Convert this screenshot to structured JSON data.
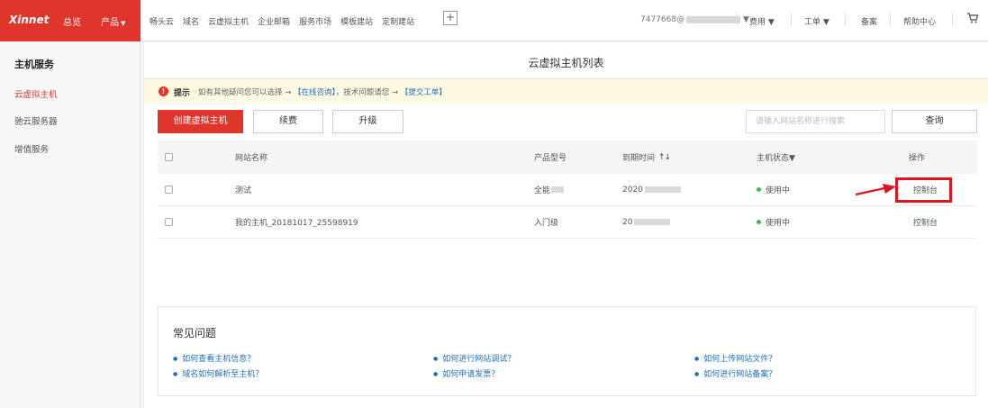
{
  "header": {
    "logo": "Xinnet",
    "overview": "总览",
    "products": "产品",
    "links": [
      "畅头云",
      "域名",
      "云虚拟主机",
      "企业邮箱",
      "服务市场",
      "模板建站",
      "定制建站"
    ],
    "plus": "+",
    "account": "7477668@",
    "fees": "费用",
    "tickets": "工单",
    "record": "备案",
    "help": "帮助中心"
  },
  "sidebar": {
    "title": "主机服务",
    "items": [
      {
        "label": "云虚拟主机",
        "active": true
      },
      {
        "label": "驰云服务器",
        "active": false
      },
      {
        "label": "增值服务",
        "active": false
      }
    ]
  },
  "main": {
    "title": "云虚拟主机列表",
    "tip": {
      "label": "提示",
      "text_a": "如有其他疑问您可以选择 → ",
      "link_a": "【在线咨询】",
      "text_b": "，技术问题请您 → ",
      "link_b": "【提交工单】"
    },
    "buttons": {
      "create": "创建虚拟主机",
      "renew": "续费",
      "upgrade": "升级",
      "query": "查询"
    },
    "search_placeholder": "请输入网站名称进行搜索",
    "table": {
      "headers": {
        "name": "网站名称",
        "model": "产品型号",
        "expire": "到期时间",
        "sort": "↑↓",
        "status": "主机状态▼",
        "op": "操作"
      },
      "rows": [
        {
          "name": "测试",
          "model": "全能",
          "expire": "2020",
          "status": "使用中",
          "op": "控制台"
        },
        {
          "name": "我的主机_20181017_25598919",
          "model": "入门级",
          "expire": "20",
          "status": "使用中",
          "op": "控制台"
        }
      ]
    }
  },
  "faq": {
    "title": "常见问题",
    "links": [
      "如何查看主机信息？",
      "如何进行网站调试？",
      "如何上传网站文件？",
      "域名如何解析至主机？",
      "如何申请发票？",
      "如何进行网站备案？"
    ]
  },
  "colors": {
    "brand": "#e0352b",
    "link": "#1f6fbd",
    "status_ok": "#3dba4e",
    "highlight": "#e0141e"
  }
}
